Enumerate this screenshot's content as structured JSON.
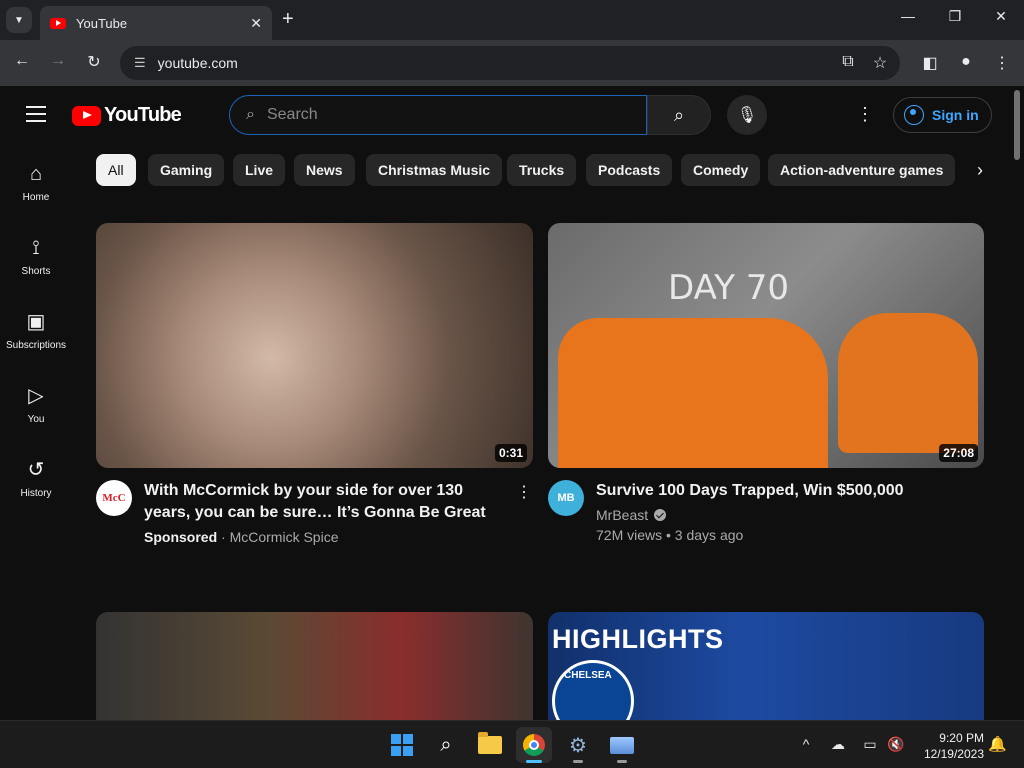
{
  "browser": {
    "tab_title": "YouTube",
    "tab_close": "✕",
    "new_tab": "+",
    "url": "youtube.com"
  },
  "youtube": {
    "logo_text": "YouTube",
    "search_placeholder": "Search",
    "sign_in": "Sign in",
    "sidebar": [
      {
        "label": "Home",
        "icon": "home-icon"
      },
      {
        "label": "Shorts",
        "icon": "shorts-icon"
      },
      {
        "label": "Subscriptions",
        "icon": "subscriptions-icon"
      },
      {
        "label": "You",
        "icon": "you-icon"
      },
      {
        "label": "History",
        "icon": "history-icon"
      }
    ],
    "chips": [
      "All",
      "Gaming",
      "Live",
      "News",
      "Christmas Music",
      "Trucks",
      "Podcasts",
      "Comedy",
      "Action-adventure games"
    ],
    "videos": [
      {
        "title": "With McCormick by your side for over 130 years, you can be sure… It’s Gonna Be Great",
        "duration": "0:31",
        "sponsored": "Sponsored",
        "channel": "McCormick Spice",
        "avatar_text": "McC"
      },
      {
        "title": "Survive 100 Days Trapped, Win $500,000",
        "duration": "27:08",
        "channel": "MrBeast",
        "views_age": "72M views • 3 days ago",
        "thumb_text": "DAY 70",
        "avatar_text": "MB"
      },
      {
        "title": "",
        "duration": ""
      },
      {
        "thumb_text": "HIGHLIGHTS",
        "crest_text": "CHELSEA"
      }
    ]
  },
  "taskbar": {
    "time": "9:20 PM",
    "date": "12/19/2023"
  },
  "colors": {
    "accent": "#3ea6ff",
    "youtube_red": "#ff0000",
    "background": "#0f0f0f",
    "chip": "#272727"
  }
}
